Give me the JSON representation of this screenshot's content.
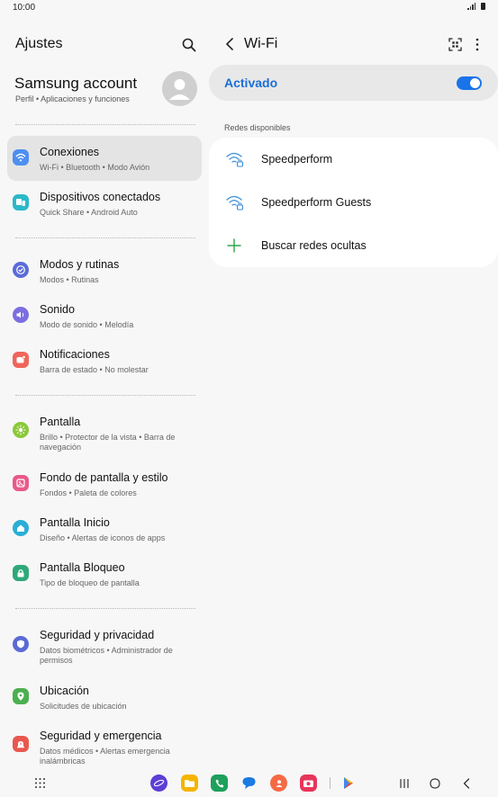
{
  "status": {
    "time": "10:00"
  },
  "left": {
    "title": "Ajustes",
    "account": {
      "name": "Samsung account",
      "subtitle": "Perfil  •  Aplicaciones y funciones"
    },
    "items": [
      {
        "title": "Conexiones",
        "subtitle": "Wi-Fi  •  Bluetooth  •  Modo Avión",
        "icon": "wifi-icon",
        "color": "#4d8ff0",
        "active": true
      },
      {
        "title": "Dispositivos conectados",
        "subtitle": "Quick Share  •  Android Auto",
        "icon": "devices-icon",
        "color": "#2bb8c9"
      },
      {
        "title": "Modos y rutinas",
        "subtitle": "Modos  •  Rutinas",
        "icon": "check-circle-icon",
        "color": "#5c6bd8"
      },
      {
        "title": "Sonido",
        "subtitle": "Modo de sonido  •  Melodía",
        "icon": "speaker-icon",
        "color": "#7b6ee0"
      },
      {
        "title": "Notificaciones",
        "subtitle": "Barra de estado  •  No molestar",
        "icon": "notification-icon",
        "color": "#f0655a"
      },
      {
        "title": "Pantalla",
        "subtitle": "Brillo  •  Protector de la vista  •  Barra de navegación",
        "icon": "sun-icon",
        "color": "#8ac83a"
      },
      {
        "title": "Fondo de pantalla y estilo",
        "subtitle": "Fondos  •  Paleta de colores",
        "icon": "palette-icon",
        "color": "#e85a8a"
      },
      {
        "title": "Pantalla Inicio",
        "subtitle": "Diseño  •  Alertas de iconos de apps",
        "icon": "home-icon",
        "color": "#2aaed6"
      },
      {
        "title": "Pantalla Bloqueo",
        "subtitle": "Tipo de bloqueo de pantalla",
        "icon": "lock-icon",
        "color": "#2fa87a"
      },
      {
        "title": "Seguridad y privacidad",
        "subtitle": "Datos biométricos  •  Administrador de permisos",
        "icon": "shield-icon",
        "color": "#5a6ad6"
      },
      {
        "title": "Ubicación",
        "subtitle": "Solicitudes de ubicación",
        "icon": "location-icon",
        "color": "#4caf50"
      },
      {
        "title": "Seguridad y emergencia",
        "subtitle": "Datos médicos  •  Alertas emergencia inalámbricas",
        "icon": "emergency-icon",
        "color": "#e8584f"
      }
    ]
  },
  "right": {
    "title": "Wi-Fi",
    "toggle_label": "Activado",
    "section_label": "Redes disponibles",
    "networks": [
      {
        "label": "Speedperform",
        "icon": "wifi-lock-icon"
      },
      {
        "label": "Speedperform Guests",
        "icon": "wifi-lock-icon"
      },
      {
        "label": "Buscar redes ocultas",
        "icon": "plus-icon"
      }
    ]
  },
  "colors": {
    "accent": "#1a73e8",
    "active_item_bg": "#e4e4e4"
  }
}
